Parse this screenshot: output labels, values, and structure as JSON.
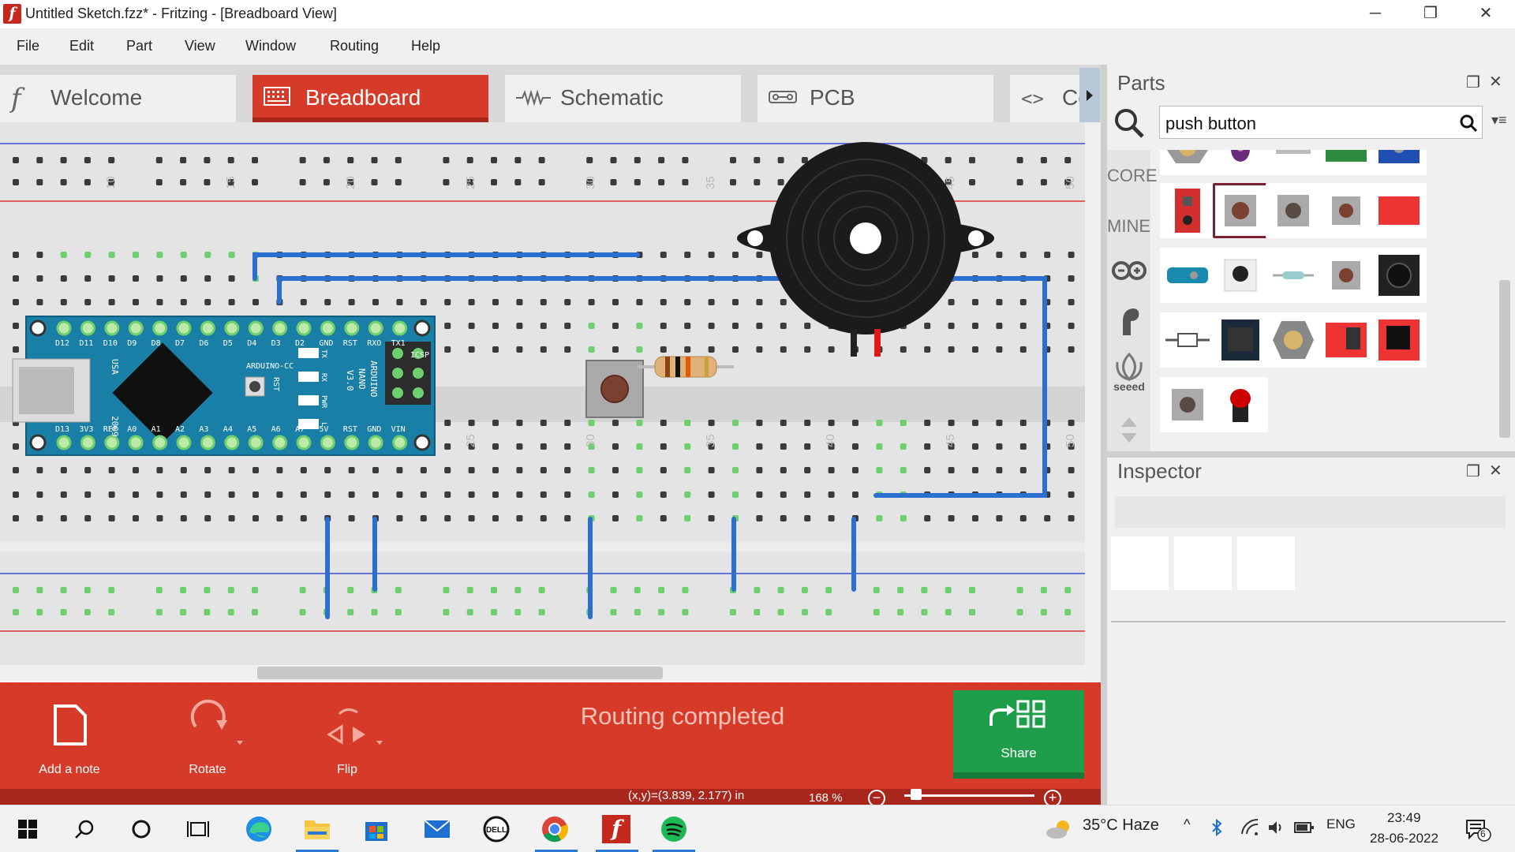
{
  "window": {
    "title": "Untitled Sketch.fzz* - Fritzing - [Breadboard View]",
    "logo": "f",
    "minimize": "─",
    "maximize": "❐",
    "close": "✕"
  },
  "menu": [
    "File",
    "Edit",
    "Part",
    "View",
    "Window",
    "Routing",
    "Help"
  ],
  "tabs": [
    {
      "label": "Welcome",
      "icon": "fritzing-logo-icon"
    },
    {
      "label": "Breadboard",
      "icon": "breadboard-icon"
    },
    {
      "label": "Schematic",
      "icon": "schematic-icon"
    },
    {
      "label": "PCB",
      "icon": "pcb-icon"
    },
    {
      "label": "Cod",
      "icon": "code-icon"
    }
  ],
  "breadboard": {
    "column_labels": [
      "10",
      "15",
      "20",
      "25",
      "30",
      "35",
      "40",
      "45",
      "50"
    ],
    "arduino": {
      "top_pins": [
        "D12",
        "D11",
        "D10",
        "D9",
        "D8",
        "D7",
        "D6",
        "D5",
        "D4",
        "D3",
        "D2",
        "GND",
        "RST",
        "RXO",
        "TX1"
      ],
      "bottom_pins": [
        "D13",
        "3V3",
        "REF",
        "A0",
        "A1",
        "A2",
        "A3",
        "A4",
        "A5",
        "A6",
        "A7",
        "5V",
        "RST",
        "GND",
        "VIN"
      ],
      "labels": [
        "ARDUINO-CC",
        "USA",
        "2009",
        "RST",
        "ICSP",
        "ARDUINO",
        "NANO",
        "V3.0",
        "TX",
        "RX",
        "PWR",
        "L"
      ]
    },
    "accent_colors": {
      "wire": "#2b6fd1",
      "pin_green": "#6ecf6e",
      "board": "#1a7fa6",
      "buzzer": "#1b1b1b"
    }
  },
  "bottom_bar": {
    "add_note": "Add a note",
    "rotate": "Rotate",
    "flip": "Flip",
    "routing_status": "Routing completed",
    "share": "Share"
  },
  "status": {
    "coords": "(x,y)=(3.839, 2.177) in",
    "zoom": "168 %",
    "zoom_level_fraction": 0.05,
    "zoom_out": "−",
    "zoom_in": "+"
  },
  "parts_panel": {
    "title": "Parts",
    "search_value": "push button",
    "categories": [
      "CORE",
      "MINE",
      "arduino-icon",
      "fritzing-hand-icon",
      "seeed"
    ]
  },
  "inspector": {
    "title": "Inspector"
  },
  "taskbar": {
    "apps": [
      "windows-start-icon",
      "search-icon",
      "cortana-icon",
      "task-view-icon",
      "edge-icon",
      "file-explorer-icon",
      "microsoft-store-icon",
      "mail-icon",
      "dell-icon",
      "chrome-icon",
      "fritzing-icon",
      "spotify-icon"
    ],
    "weather": "35°C  Haze",
    "lang": "ENG",
    "time": "23:49",
    "date": "28-06-2022",
    "notifications": "6",
    "tray_up": "^"
  }
}
